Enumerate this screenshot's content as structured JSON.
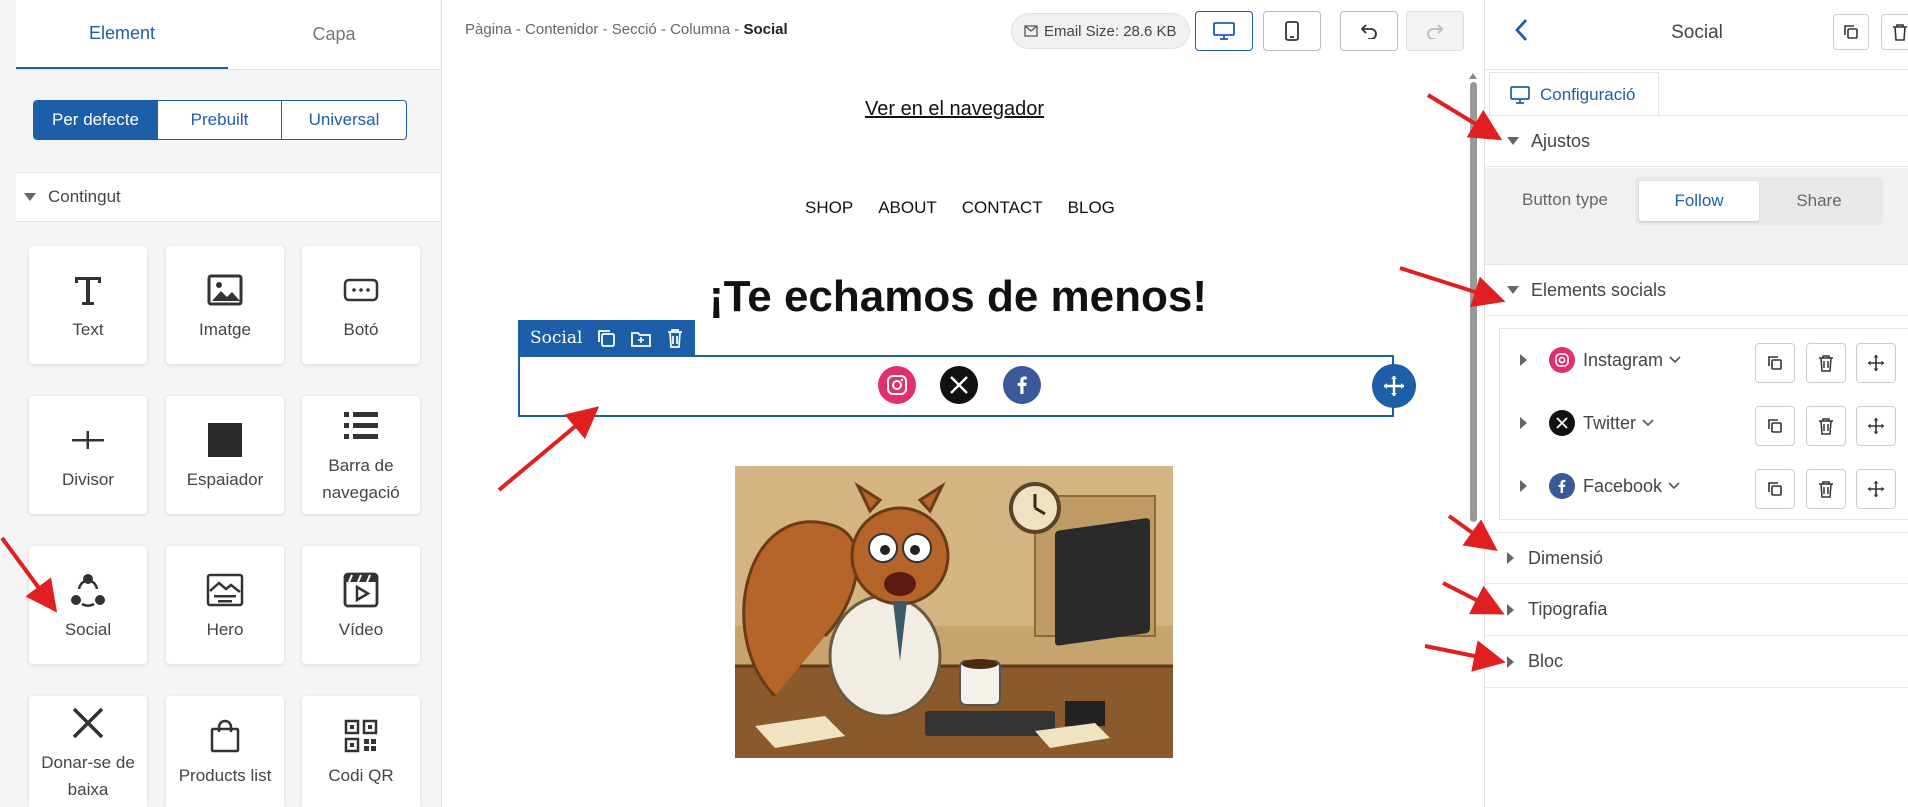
{
  "left": {
    "tabs": [
      "Element",
      "Capa"
    ],
    "segments": [
      "Per defecte",
      "Prebuilt",
      "Universal"
    ],
    "section": "Contingut",
    "cards": [
      {
        "label": "Text",
        "icon": "text-icon"
      },
      {
        "label": "Imatge",
        "icon": "image-icon"
      },
      {
        "label": "Botó",
        "icon": "button-icon"
      },
      {
        "label": "Divisor",
        "icon": "divider-icon"
      },
      {
        "label": "Espaiador",
        "icon": "spacer-icon"
      },
      {
        "label": "Barra de navegació",
        "icon": "navbar-icon"
      },
      {
        "label": "Social",
        "icon": "social-icon"
      },
      {
        "label": "Hero",
        "icon": "hero-icon"
      },
      {
        "label": "Vídeo",
        "icon": "video-icon"
      },
      {
        "label": "Donar-se de baixa",
        "icon": "unsubscribe-icon"
      },
      {
        "label": "Products list",
        "icon": "shopping-bag-icon"
      },
      {
        "label": "Codi QR",
        "icon": "qr-code-icon"
      }
    ]
  },
  "center": {
    "breadcrumb": {
      "path": "Pàgina - Contenidor - Secció - Columna - ",
      "current": "Social"
    },
    "email_size": "Email Size: 28.6 KB",
    "email": {
      "view_link": "Ver en el navegador",
      "menu": [
        "SHOP",
        "ABOUT",
        "CONTACT",
        "BLOG"
      ],
      "headline": "¡Te echamos de menos!",
      "selection_label": "Social"
    }
  },
  "right": {
    "title": "Social",
    "tab": "Configuració",
    "sections": {
      "ajustos": "Ajustos",
      "button_type_label": "Button type",
      "button_type_options": [
        "Follow",
        "Share"
      ],
      "elements_socials": "Elements socials",
      "dimensio": "Dimensió",
      "tipografia": "Tipografia",
      "bloc": "Bloc"
    },
    "social_items": [
      {
        "name": "Instagram",
        "color": "#e1306c"
      },
      {
        "name": "Twitter",
        "color": "#111111"
      },
      {
        "name": "Facebook",
        "color": "#3b5998"
      }
    ]
  },
  "colors": {
    "accent": "#1c5fa8",
    "annotation": "#e02020"
  }
}
